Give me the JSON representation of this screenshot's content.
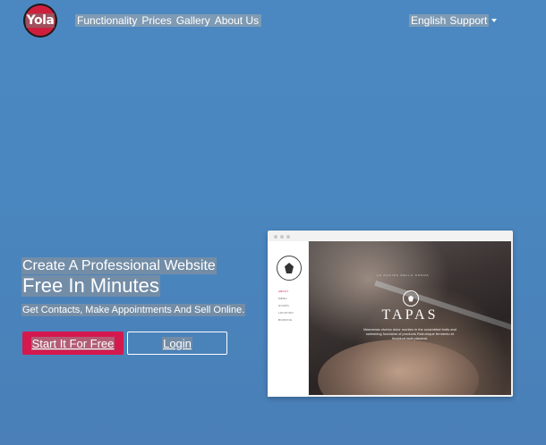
{
  "brand": {
    "logo_text": "Yola"
  },
  "nav": {
    "items": [
      {
        "label": "Functionality"
      },
      {
        "label": "Prices"
      },
      {
        "label": "Gallery"
      },
      {
        "label": "About Us"
      }
    ],
    "right": {
      "language": "English",
      "support": "Support"
    }
  },
  "hero": {
    "title_line1": "Create A Professional Website",
    "title_line2": "Free In Minutes",
    "subtitle": "Get Contacts, Make Appointments And Sell Online.",
    "cta_primary": "Start It For Free",
    "cta_secondary": "Login"
  },
  "mockup": {
    "menu": [
      "ABOUT",
      "MENU",
      "HOURS",
      "LOCATION",
      "BOOKING"
    ],
    "tagline": "LA CUCINA DELLA NONNA",
    "site_title": "TAPAS",
    "description": "Maecenas viverra dolor montes in the scrambled fruits and swimming fountains of products Rutrumque fermentu et tincidunt tacit placerat."
  },
  "colors": {
    "background": "#4a86bf",
    "brand_red": "#d4194f",
    "logo_red": "#cf1f3d"
  },
  "icons": [
    "dropdown-caret-icon"
  ]
}
